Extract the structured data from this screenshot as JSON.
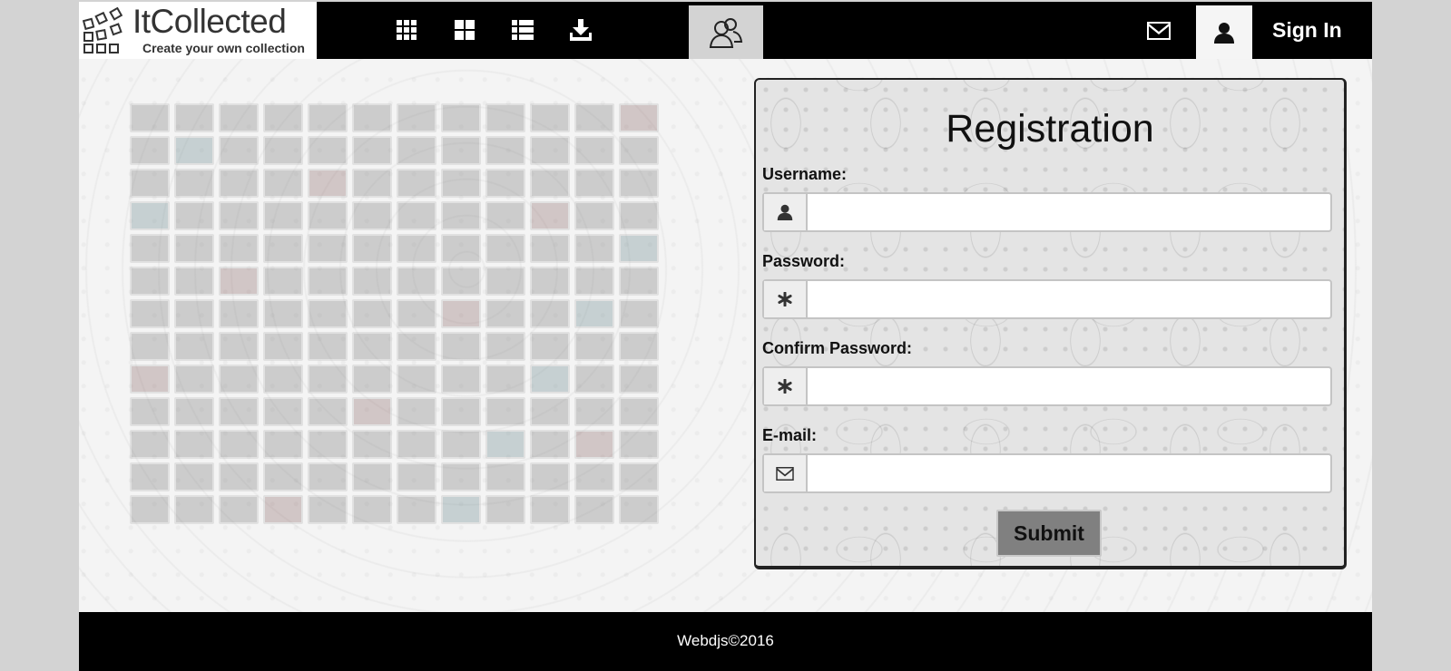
{
  "brand": {
    "title": "ItCollected",
    "tagline": "Create your own collection"
  },
  "header": {
    "nav_icons": [
      "grid-small-icon",
      "grid-large-icon",
      "list-icon",
      "download-icon"
    ],
    "users_icon": "users-icon",
    "mail_icon": "mail-icon",
    "user_icon": "user-icon",
    "signin_label": "Sign In"
  },
  "registration": {
    "title": "Registration",
    "username": {
      "label": "Username:",
      "icon": "user-icon",
      "value": ""
    },
    "password": {
      "label": "Password:",
      "icon": "asterisk-icon",
      "value": ""
    },
    "confirm_password": {
      "label": "Confirm Password:",
      "icon": "asterisk-icon",
      "value": ""
    },
    "email": {
      "label": "E-mail:",
      "icon": "mail-icon",
      "value": ""
    },
    "submit_label": "Submit"
  },
  "footer": {
    "text": "Webdjs©2016"
  }
}
